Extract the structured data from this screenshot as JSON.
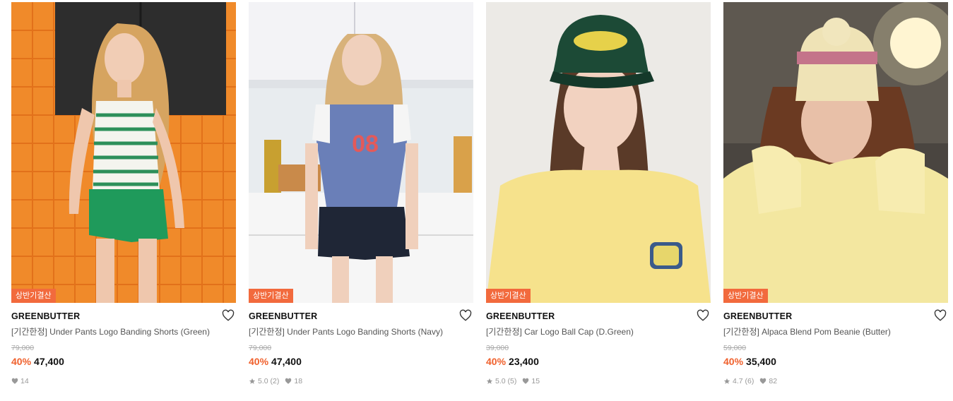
{
  "products": [
    {
      "badge": "상반기결산",
      "brand": "GREENBUTTER",
      "name": "[기간한정] Under Pants Logo Banding Shorts (Green)",
      "original_price": "79,000",
      "discount": "40%",
      "price": "47,400",
      "rating": "",
      "review_count": "",
      "likes": "14",
      "image_alt": "model in striped tank and green shorts against orange tiles"
    },
    {
      "badge": "상반기결산",
      "brand": "GREENBUTTER",
      "name": "[기간한정] Under Pants Logo Banding Shorts (Navy)",
      "original_price": "79,000",
      "discount": "40%",
      "price": "47,400",
      "rating": "5.0",
      "review_count": "(2)",
      "likes": "18",
      "image_alt": "model in blue 08 tee and navy shorts in kitchen"
    },
    {
      "badge": "상반기결산",
      "brand": "GREENBUTTER",
      "name": "[기간한정] Car Logo Ball Cap (D.Green)",
      "original_price": "39,000",
      "discount": "40%",
      "price": "23,400",
      "rating": "5.0",
      "review_count": "(5)",
      "likes": "15",
      "image_alt": "model wearing dark green cap and yellow tee"
    },
    {
      "badge": "상반기결산",
      "brand": "GREENBUTTER",
      "name": "[기간한정] Alpaca Blend Pom Beanie (Butter)",
      "original_price": "59,000",
      "discount": "40%",
      "price": "35,400",
      "rating": "4.7",
      "review_count": "(6)",
      "likes": "82",
      "image_alt": "model wearing butter pom beanie and yellow puffer"
    }
  ],
  "colors": {
    "badge_bg": "#f26a3d",
    "discount": "#f0612d"
  }
}
